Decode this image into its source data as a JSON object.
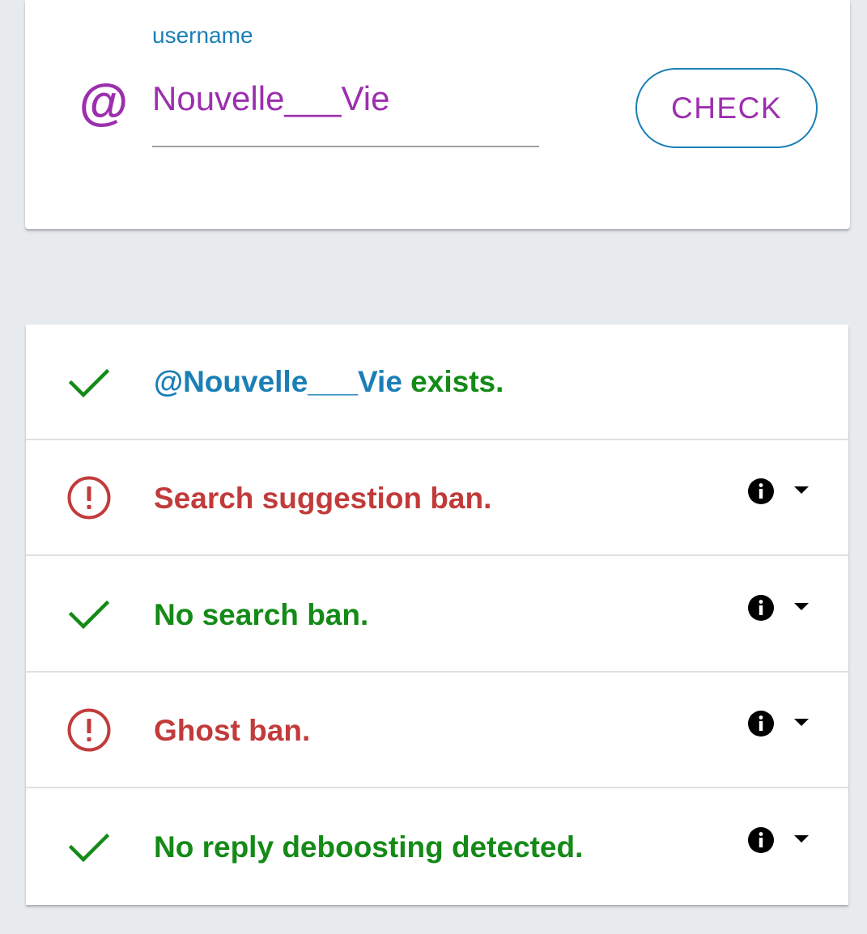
{
  "form": {
    "label": "username",
    "at_symbol": "@",
    "username_value": "Nouvelle___Vie",
    "check_label": "CHECK"
  },
  "results": {
    "exists": {
      "handle": "@Nouvelle___Vie",
      "suffix": " exists.",
      "status": "ok",
      "icon": "check-icon"
    },
    "items": [
      {
        "label": "Search suggestion ban.",
        "status": "warn",
        "icon": "alert-circle-icon"
      },
      {
        "label": "No search ban.",
        "status": "ok",
        "icon": "check-icon"
      },
      {
        "label": "Ghost ban.",
        "status": "warn",
        "icon": "alert-circle-icon"
      },
      {
        "label": "No reply deboosting detected.",
        "status": "ok",
        "icon": "check-icon"
      }
    ]
  },
  "colors": {
    "accent_purple": "#9c2fae",
    "link_blue": "#1b7fb6",
    "ok_green": "#148a17",
    "warn_red": "#c23b3b",
    "background": "#e7ebee"
  }
}
